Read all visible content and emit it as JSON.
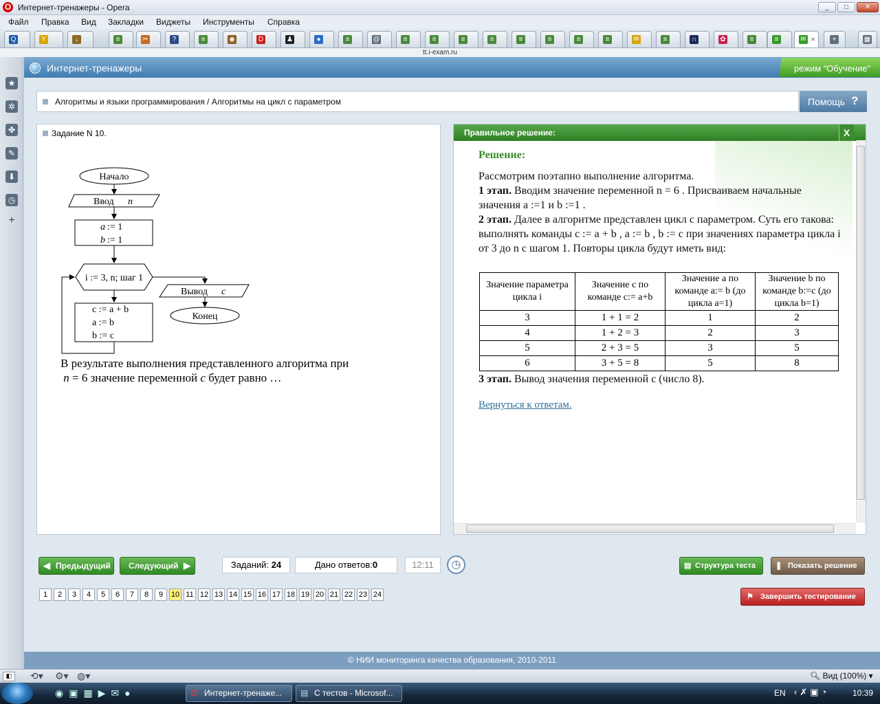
{
  "window": {
    "title": "Интернет-тренажеры - Opera"
  },
  "menu": [
    "Файл",
    "Правка",
    "Вид",
    "Закладки",
    "Виджеты",
    "Инструменты",
    "Справка"
  ],
  "address": "tt.i-exam.ru",
  "app": {
    "title": "Интернет-тренажеры",
    "mode": "режим “Обучение”"
  },
  "breadcrumb": "Алгоритмы и языки программирования / Алгоритмы на цикл с параметром",
  "help_label": "Помощь",
  "task": {
    "header": "Задание N 10.",
    "flow": {
      "start": "Начало",
      "input": "Ввод",
      "input_var": "n",
      "init1_var": "a",
      "init1_val": ":= 1",
      "init2_var": "b",
      "init2_val": ":= 1",
      "loop": "i := 3, n; шаг 1",
      "body1": "c := a + b",
      "body2": "a := b",
      "body3": "b := c",
      "output": "Вывод",
      "output_var": "c",
      "end": "Конец"
    },
    "question_part1": "В результате выполнения представленного алгоритма при",
    "question_n": "n",
    "question_part2": "= 6  значение переменной",
    "question_var": "c",
    "question_part3": "будет равно …"
  },
  "solution": {
    "header": "Правильное решение:",
    "close": "X",
    "title": "Решение:",
    "intro": "Рассмотрим поэтапно выполнение алгоритма.",
    "step1_label": "1 этап.",
    "step1_text": "Вводим значение переменной n = 6 . Присваиваем начальные значения a :=1 и b :=1 .",
    "step2_label": "2 этап.",
    "step2_text": "Далее в алгоритме представлен цикл с параметром. Суть его такова: выполнять команды c := a + b , a := b , b := c при значениях параметра цикла i от 3 до n с шагом 1. Повторы цикла будут иметь вид:",
    "table_headers": [
      "Значение параметра цикла i",
      "Значение c по команде c:= a+b",
      "Значение a по команде a:= b (до цикла a=1)",
      "Значение b по команде b:=c (до цикла b=1)"
    ],
    "table_rows": [
      [
        "3",
        "1 + 1 = 2",
        "1",
        "2"
      ],
      [
        "4",
        "1 + 2 = 3",
        "2",
        "3"
      ],
      [
        "5",
        "2 + 3 = 5",
        "3",
        "5"
      ],
      [
        "6",
        "3 + 5 = 8",
        "5",
        "8"
      ]
    ],
    "step3_label": "3 этап.",
    "step3_text": "Вывод значения переменной c (число 8).",
    "back_link": "Вернуться к ответам."
  },
  "controls": {
    "prev": "Предыдущий",
    "next": "Следующий",
    "tasks_label": "Заданий:",
    "tasks_count": "24",
    "answers_label": "Дано ответов:",
    "answers_count": "0",
    "timer": "12:11",
    "structure": "Структура теста",
    "show_solution": "Показать решение",
    "finish": "Завершить тестирование"
  },
  "pages": [
    "1",
    "2",
    "3",
    "4",
    "5",
    "6",
    "7",
    "8",
    "9",
    "10",
    "11",
    "12",
    "13",
    "14",
    "15",
    "16",
    "17",
    "18",
    "19",
    "20",
    "21",
    "22",
    "23",
    "24"
  ],
  "current_page": "10",
  "footer": "© НИИ мониторинга качества образования, 2010-2011",
  "statusbar": {
    "zoom": "Вид (100%)"
  },
  "taskbar": {
    "items": [
      "Интернет-тренаже...",
      "С тестов - Microsof..."
    ],
    "lang": "EN",
    "clock": "10:39"
  },
  "colors": {
    "accent_blue": "#3f7cb2",
    "green": "#2f8a23",
    "red": "#c8262a",
    "page_current": "#fff27a"
  }
}
